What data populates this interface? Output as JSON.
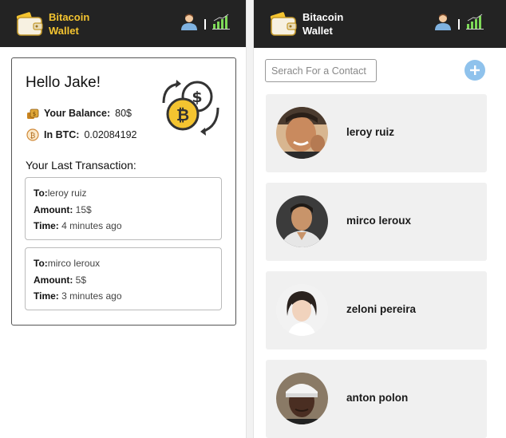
{
  "brand": {
    "line1": "Bitacoin",
    "line2": "Wallet"
  },
  "icons": {
    "logo": "wallet-icon",
    "user": "user-icon",
    "stats": "signal-chart-icon",
    "add": "plus-icon",
    "balance": "coins-icon",
    "btc": "bitcoin-coin-icon"
  },
  "colors": {
    "topbar": "#232323",
    "brand_left": "#f4c430",
    "brand_right": "#ffffff",
    "add_button": "#8fc2ec",
    "contact_bg": "#f0f0f0",
    "chart_icon": "#7ed957"
  },
  "home": {
    "greeting": "Hello Jake!",
    "balance_label": "Your Balance:",
    "balance_value": "80$",
    "btc_label": "In BTC:",
    "btc_value": "0.02084192",
    "last_title": "Your Last Transaction:",
    "transactions": [
      {
        "to_label": "To:",
        "to": "leroy ruiz",
        "amount_label": "Amount:",
        "amount": "15$",
        "time_label": "Time:",
        "time": "4 minutes ago"
      },
      {
        "to_label": "To:",
        "to": "mirco leroux",
        "amount_label": "Amount:",
        "amount": "5$",
        "time_label": "Time:",
        "time": "3 minutes ago"
      }
    ]
  },
  "contacts": {
    "search_placeholder": "Serach For a Contact",
    "list": [
      {
        "name": "leroy ruiz"
      },
      {
        "name": "mirco leroux"
      },
      {
        "name": "zeloni pereira"
      },
      {
        "name": "anton polon"
      }
    ]
  }
}
